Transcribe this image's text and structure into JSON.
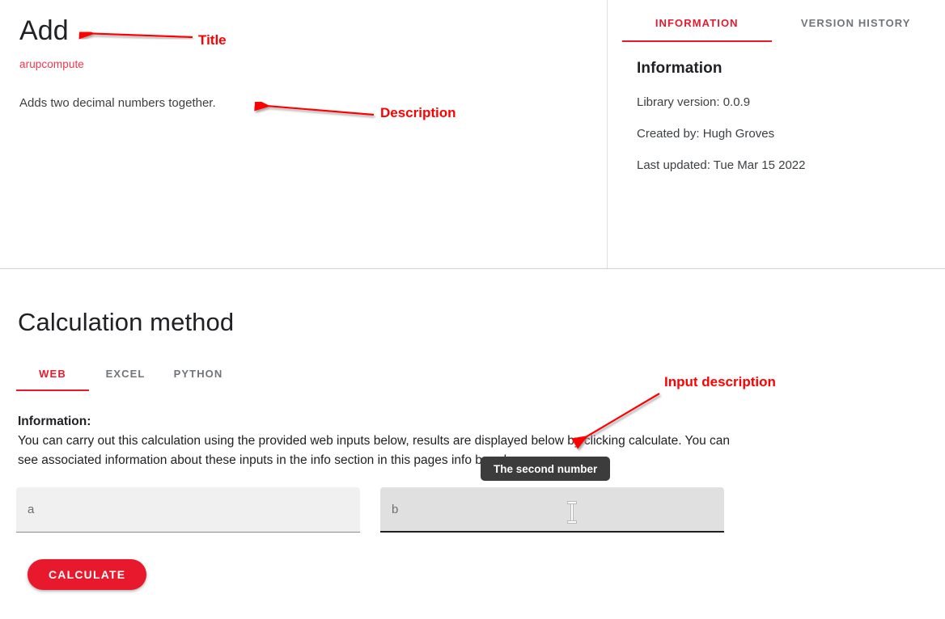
{
  "page": {
    "title": "Add",
    "breadcrumb": "arupcompute",
    "description": "Adds two decimal numbers together."
  },
  "info_panel": {
    "tabs": [
      {
        "label": "INFORMATION",
        "active": true
      },
      {
        "label": "VERSION HISTORY",
        "active": false
      }
    ],
    "heading": "Information",
    "lines": [
      "Library version: 0.0.9",
      "Created by: Hugh Groves",
      "Last updated: Tue Mar 15 2022"
    ]
  },
  "calculation": {
    "section_title": "Calculation method",
    "tabs": [
      {
        "label": "WEB",
        "active": true
      },
      {
        "label": "EXCEL",
        "active": false
      },
      {
        "label": "PYTHON",
        "active": false
      }
    ],
    "information_label": "Information:",
    "information_text": "You can carry out this calculation using the provided web inputs below, results are displayed below by clicking calculate. You can see associated information about these inputs in the info section in this pages info bar above.",
    "inputs": [
      {
        "placeholder": "a",
        "value": "",
        "hovered": false
      },
      {
        "placeholder": "b",
        "value": "",
        "hovered": true
      }
    ],
    "calculate_label": "CALCULATE"
  },
  "tooltip": {
    "text": "The second number"
  },
  "annotations": [
    {
      "label": "Title"
    },
    {
      "label": "Description"
    },
    {
      "label": "Input description"
    }
  ],
  "colors": {
    "accent_red": "#e8192c",
    "annotation_red": "#ff0000",
    "link_red": "#f4364c",
    "tooltip_bg": "#3c3c3c",
    "input_bg": "#f0f0f0",
    "input_bg_hover": "#e0e0e0"
  }
}
